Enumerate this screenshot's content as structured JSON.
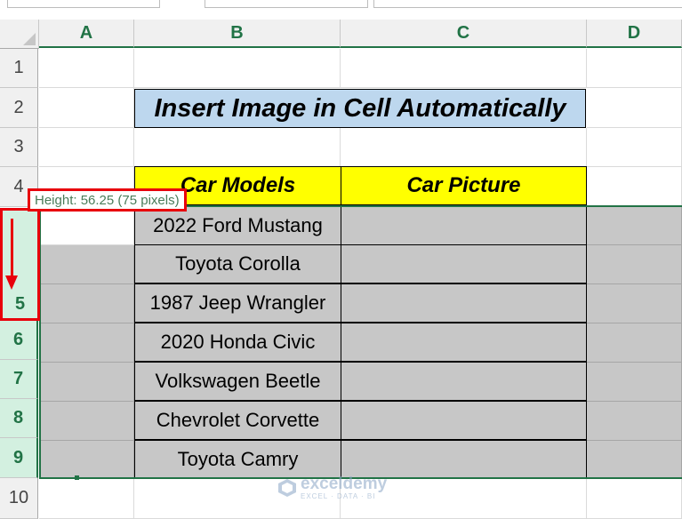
{
  "columns": [
    "A",
    "B",
    "C",
    "D"
  ],
  "rows": [
    "1",
    "2",
    "3",
    "4",
    "5",
    "6",
    "7",
    "8",
    "9",
    "10"
  ],
  "title": "Insert Image in Cell Automatically",
  "table": {
    "headers": [
      "Car Models",
      "Car Picture"
    ],
    "models": [
      "2022 Ford Mustang",
      "Toyota Corolla",
      "1987 Jeep Wrangler",
      "2020 Honda Civic",
      "Volkswagen Beetle",
      "Chevrolet Corvette",
      "Toyota Camry"
    ]
  },
  "tooltip": "Height: 56.25 (75 pixels)",
  "watermark": {
    "name": "exceldemy",
    "tagline": "EXCEL · DATA · BI"
  },
  "colors": {
    "accent": "#217346",
    "title_fill": "#bdd7ee",
    "header_fill": "#ffff00",
    "selection": "#c7c7c7",
    "annotation": "#e8000b"
  }
}
